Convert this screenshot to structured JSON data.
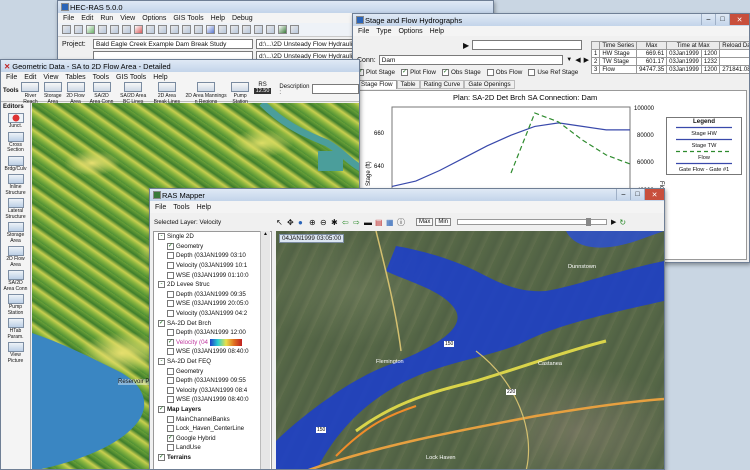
{
  "hecras": {
    "title": "HEC-RAS 5.0.0",
    "menu": [
      "File",
      "Edit",
      "Run",
      "View",
      "Options",
      "GIS Tools",
      "Help",
      "Debug"
    ],
    "project_label": "Project:",
    "project_value": "Bald Eagle Creek Example Dam Break Study",
    "path_value": "d:\\...\\2D Unsteady Flow Hydraulics\\Ba",
    "row2_value": "d:\\...\\2D Unsteady Flow Hydraulics\\Ba"
  },
  "geom": {
    "title": "Geometric Data - SA to 2D Flow Area - Detailed",
    "menu": [
      "File",
      "Edit",
      "View",
      "Tables",
      "Tools",
      "GIS Tools",
      "Help"
    ],
    "toolbar_tools_label": "Tools",
    "toolbar": [
      "River Reach",
      "Storage Area",
      "2D Flow Area",
      "SA/2D Area Conn",
      "SA/2D Area BC Lines",
      "2D Area Break Lines",
      "2D Area Mannings n Regions",
      "Pump Station",
      "RS"
    ],
    "rs_value": "12.50",
    "description_label": "Description :",
    "editors_label": "Editors",
    "editors": [
      "Junct.",
      "Cross Section",
      "Brdg/Culv",
      "Inline Structure",
      "Lateral Structure",
      "Storage Area",
      "2D Flow Area",
      "SA/2D Area Conn",
      "Pump Station",
      "HTab Param.",
      "View Picture"
    ],
    "map_label": "Reservoir Po"
  },
  "hydro": {
    "title": "Stage and Flow Hydrographs",
    "menu": [
      "File",
      "Type",
      "Options",
      "Help"
    ],
    "conn_label": "Conn:",
    "conn_value": "Dam",
    "checks": [
      {
        "label": "Plot Stage",
        "checked": true
      },
      {
        "label": "Plot Flow",
        "checked": true
      },
      {
        "label": "Obs Stage",
        "checked": true
      },
      {
        "label": "Obs Flow",
        "checked": false
      },
      {
        "label": "Use Ref Stage",
        "checked": false
      }
    ],
    "tabs": [
      "Stage Flow",
      "Table",
      "Rating Curve",
      "Gate Openings"
    ],
    "table_headers": [
      "Time Series",
      "Max",
      "Time at Max",
      "Reload Data"
    ],
    "table_rows": [
      {
        "n": "1",
        "series": "HW Stage",
        "max": "669.61",
        "time": "03Jan1999",
        "t2": "1200"
      },
      {
        "n": "2",
        "series": "TW Stage",
        "max": "601.17",
        "time": "03Jan1999",
        "t2": "1232"
      },
      {
        "n": "3",
        "series": "Flow",
        "max": "94747.35",
        "time": "03Jan1999",
        "t2": "1200",
        "extra": "271841.08"
      }
    ],
    "plan_title": "Plan: SA-2D Det Brch    SA Connection: Dam",
    "legend_title": "Legend",
    "legend": [
      {
        "label": "Stage HW",
        "color": "#3949ab",
        "dash": ""
      },
      {
        "label": "Stage TW",
        "color": "#3949ab",
        "dash": ""
      },
      {
        "label": "Flow",
        "color": "#2e8b2e",
        "dash": "4,3"
      },
      {
        "label": "Gate Flow - Gate #1",
        "color": "#3949ab",
        "dash": ""
      }
    ],
    "ylabel_left": "Stage (ft)",
    "ylabel_right": "Flow (cfs)",
    "left_ticks": [
      "660",
      "640",
      "620",
      "600"
    ],
    "right_ticks": [
      "100000",
      "80000",
      "60000",
      "40000",
      "20000"
    ]
  },
  "chart_data": {
    "type": "line",
    "title": "Plan: SA-2D Det Brch    SA Connection: Dam",
    "ylabel": "Stage (ft)",
    "y2label": "Flow (cfs)",
    "ylim": [
      590,
      675
    ],
    "y2lim": [
      0,
      100000
    ],
    "x": [
      0,
      1,
      2,
      3,
      4,
      5,
      6,
      7,
      8,
      9,
      10
    ],
    "series": [
      {
        "name": "Stage HW",
        "axis": "left",
        "values": [
          630,
          633,
          639,
          646,
          653,
          659,
          664,
          666,
          664,
          662,
          662
        ]
      },
      {
        "name": "Flow",
        "axis": "right",
        "values": [
          null,
          null,
          null,
          null,
          null,
          56000,
          96000,
          90000,
          78000,
          68000,
          62000
        ]
      }
    ]
  },
  "mapper": {
    "title": "RAS Mapper",
    "menu": [
      "File",
      "Tools",
      "Help"
    ],
    "selected_layer": "Selected Layer: Velocity",
    "max_label": "Max",
    "min_label": "Min",
    "timestamp": "04JAN1999 03:05:00",
    "tree": [
      {
        "indent": 0,
        "cb": "-",
        "text": "Single 2D",
        "bold": false
      },
      {
        "indent": 1,
        "cb": "✓",
        "text": "Geometry",
        "bold": false
      },
      {
        "indent": 1,
        "cb": "",
        "text": "Depth (03JAN1999 03:10",
        "bold": false
      },
      {
        "indent": 1,
        "cb": "",
        "text": "Velocity (03JAN1999 10:1",
        "bold": false
      },
      {
        "indent": 1,
        "cb": "",
        "text": "WSE (03JAN1999 01:10:0",
        "bold": false
      },
      {
        "indent": 0,
        "cb": "-",
        "text": "2D Levee Struc",
        "bold": false
      },
      {
        "indent": 1,
        "cb": "",
        "text": "Depth (03JAN1999 09:35",
        "bold": false
      },
      {
        "indent": 1,
        "cb": "",
        "text": "WSE (03JAN1999 20:05:0",
        "bold": false
      },
      {
        "indent": 1,
        "cb": "",
        "text": "Velocity (03JAN1999 04:2",
        "bold": false
      },
      {
        "indent": 0,
        "cb": "✓",
        "text": "SA-2D Det Brch",
        "bold": false
      },
      {
        "indent": 1,
        "cb": "",
        "text": "Depth (03JAN1999 12:00",
        "bold": false
      },
      {
        "indent": 1,
        "cb": "✓",
        "text": "Velocity (04",
        "bold": false,
        "ramp": true
      },
      {
        "indent": 1,
        "cb": "",
        "text": "WSE (03JAN1999 08:40:0",
        "bold": false
      },
      {
        "indent": 0,
        "cb": "-",
        "text": "SA-2D Det FEQ",
        "bold": false
      },
      {
        "indent": 1,
        "cb": "",
        "text": "Geometry",
        "bold": false
      },
      {
        "indent": 1,
        "cb": "",
        "text": "Depth (03JAN1999 09:55",
        "bold": false
      },
      {
        "indent": 1,
        "cb": "",
        "text": "Velocity (03JAN1999 08:4",
        "bold": false
      },
      {
        "indent": 1,
        "cb": "",
        "text": "WSE (03JAN1999 08:40:0",
        "bold": false
      },
      {
        "indent": 0,
        "cb": "✓",
        "text": "Map Layers",
        "bold": true
      },
      {
        "indent": 1,
        "cb": "",
        "text": "MainChannelBanks",
        "bold": false
      },
      {
        "indent": 1,
        "cb": "",
        "text": "Lock_Haven_CenterLine",
        "bold": false
      },
      {
        "indent": 1,
        "cb": "✓",
        "text": "Google Hybrid",
        "bold": false
      },
      {
        "indent": 1,
        "cb": "",
        "text": "LandUse",
        "bold": false
      },
      {
        "indent": 0,
        "cb": "✓",
        "text": "Terrains",
        "bold": true
      }
    ],
    "place_labels": [
      "Dunnstown",
      "Flemington",
      "Castanea",
      "Lock Haven"
    ],
    "road_labels": [
      "150",
      "220",
      "150"
    ]
  },
  "colors": {
    "titlebar": "#c3d4ea",
    "water": "#1d3fc9",
    "hydro_line": "#3949ab",
    "flow_line": "#2e8b2e"
  }
}
